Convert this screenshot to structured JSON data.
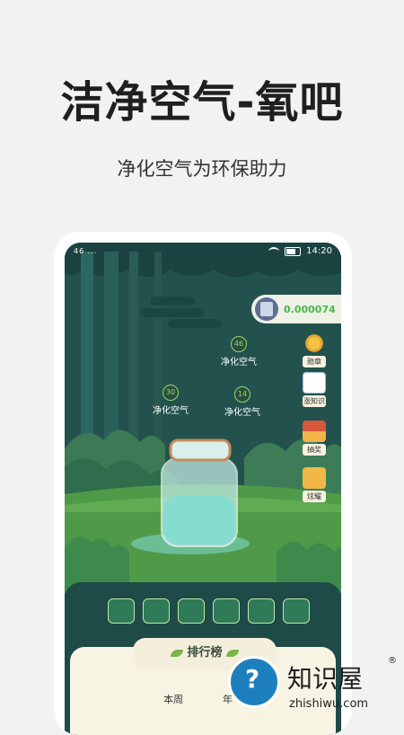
{
  "promo": {
    "title": "洁净空气-氧吧",
    "subtitle": "净化空气为环保助力"
  },
  "status_bar": {
    "left": "46 ...",
    "time": "14:20"
  },
  "profile": {
    "score": "0.000074"
  },
  "bubbles": [
    {
      "num": "46",
      "label": "净化空气"
    },
    {
      "num": "30",
      "label": "净化空气"
    },
    {
      "num": "14",
      "label": "净化空气"
    }
  ],
  "side_buttons": {
    "medal": "勋章",
    "knowledge": "涨知识",
    "lottery": "抽奖",
    "show": "炫耀"
  },
  "ranking": {
    "title": "排行榜",
    "tab_week": "本周",
    "tab_year": "年"
  },
  "watermark": {
    "brand": "知识屋",
    "url": "zhishiwu.com",
    "reg": "®"
  },
  "colors": {
    "sky": "#1f4b49",
    "grass": "#4f9a48",
    "accent_green": "#4bb74f"
  }
}
